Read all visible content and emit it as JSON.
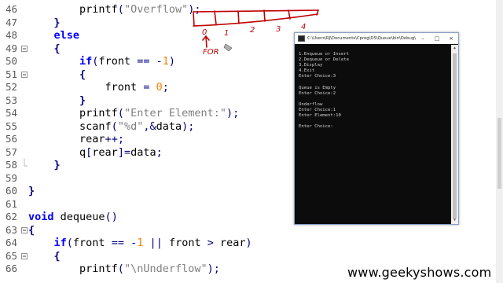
{
  "editor": {
    "lines": [
      {
        "n": "46",
        "code": "        printf(\"Overflow\");"
      },
      {
        "n": "47",
        "code": "    }"
      },
      {
        "n": "48",
        "code": "    else"
      },
      {
        "n": "49",
        "code": "    {"
      },
      {
        "n": "50",
        "code": "        if(front == -1)"
      },
      {
        "n": "51",
        "code": "        {"
      },
      {
        "n": "52",
        "code": "            front = 0;"
      },
      {
        "n": "53",
        "code": "        }"
      },
      {
        "n": "54",
        "code": "        printf(\"Enter Element:\");"
      },
      {
        "n": "55",
        "code": "        scanf(\"%d\",&data);"
      },
      {
        "n": "56",
        "code": "        rear++;"
      },
      {
        "n": "57",
        "code": "        q[rear]=data;"
      },
      {
        "n": "58",
        "code": "    }"
      },
      {
        "n": "59",
        "code": ""
      },
      {
        "n": "60",
        "code": "}"
      },
      {
        "n": "61",
        "code": ""
      },
      {
        "n": "62",
        "code": "void dequeue()"
      },
      {
        "n": "63",
        "code": "{"
      },
      {
        "n": "64",
        "code": "    if(front == -1 || front > rear)"
      },
      {
        "n": "65",
        "code": "    {"
      },
      {
        "n": "66",
        "code": "        printf(\"\\nUnderflow\");"
      }
    ]
  },
  "console": {
    "title": "C:\\Users\\RJ\\Documents\\Cprog\\DS\\Queue\\bin\\Debug\\Q...",
    "minimize": "–",
    "maximize": "□",
    "close": "×",
    "output": [
      "1.Enqueue or Insert",
      "2.Dequeue or Delete",
      "3.Display",
      "4.Exit",
      "Enter Choice:3",
      "",
      "Queue is Empty",
      "Enter Choice:2",
      "",
      "Underflow",
      "Enter Choice:1",
      "Enter Element:10",
      "",
      "Enter Choice:"
    ]
  },
  "annotation": {
    "indices": [
      "0",
      "1",
      "2",
      "3",
      "4"
    ],
    "label": "FOR",
    "ink_color": "#c00000"
  },
  "watermark": "www.geekyshows.com",
  "colors": {
    "keyword": "#0000ff",
    "string": "#808080",
    "number": "#ff8000",
    "operator": "#000080",
    "line_number": "#5a5a5a"
  }
}
